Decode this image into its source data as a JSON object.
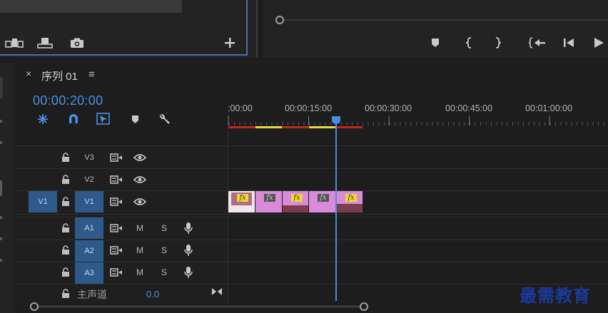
{
  "timeline": {
    "close": "×",
    "title": "序列 01",
    "menu": "≡",
    "timecode": "00:00:20:00",
    "ruler_labels": [
      ":00:00",
      "00:00:15:00",
      "00:00:30:00",
      "00:00:45:00",
      "00:01:00:00"
    ],
    "video_tracks": [
      {
        "label": "V3"
      },
      {
        "label": "V2"
      },
      {
        "label": "V1",
        "source_patch": "V1"
      }
    ],
    "audio_tracks": [
      {
        "label": "A1",
        "m": "M",
        "s": "S"
      },
      {
        "label": "A2",
        "m": "M",
        "s": "S"
      },
      {
        "label": "A3",
        "m": "M",
        "s": "S"
      }
    ],
    "master": {
      "label": "主声道",
      "value": "0.0"
    },
    "fx_label": "fx"
  },
  "colors": {
    "accent": "#4a90e2",
    "clip_pink": "#d98ad9",
    "clip_dark": "#7a3e4e",
    "render_red": "#c0281c",
    "render_yellow": "#e8d83a"
  },
  "watermark": "最需教育"
}
